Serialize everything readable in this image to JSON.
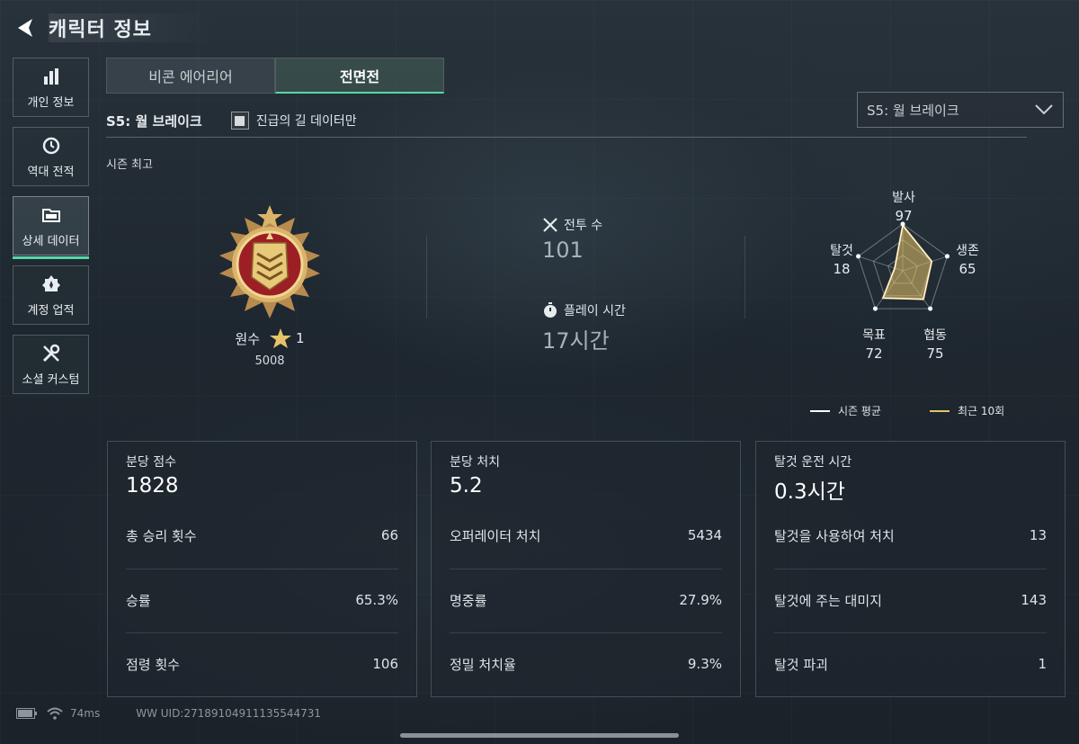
{
  "header": {
    "title": "캐릭터 정보"
  },
  "sidebar": {
    "items": [
      {
        "label": "개인 정보",
        "icon": "bar-chart-icon"
      },
      {
        "label": "역대 전적",
        "icon": "history-icon"
      },
      {
        "label": "상세 데이터",
        "icon": "folder-icon",
        "active": true
      },
      {
        "label": "계정 업적",
        "icon": "achievement-icon"
      },
      {
        "label": "소셜 커스텀",
        "icon": "tools-icon"
      }
    ]
  },
  "tabs": [
    {
      "label": "비콘 에어리어",
      "active": false
    },
    {
      "label": "전면전",
      "active": true
    }
  ],
  "season": {
    "label": "S5: 월 브레이크",
    "checkbox_label": "진급의 길 데이터만",
    "select_value": "S5: 월 브레이크"
  },
  "season_best": "시즌 최고",
  "rank": {
    "name": "원수",
    "stars": "1",
    "score": "5008"
  },
  "stats": {
    "battles_label": "전투 수",
    "battles_value": "101",
    "playtime_label": "플레이 시간",
    "playtime_value": "17시간"
  },
  "radar": {
    "axes": [
      {
        "label": "발사",
        "value": "97"
      },
      {
        "label": "생존",
        "value": "65"
      },
      {
        "label": "협동",
        "value": "75"
      },
      {
        "label": "목표",
        "value": "72"
      },
      {
        "label": "탈것",
        "value": "18"
      }
    ],
    "legend_avg": "시즌 평균",
    "legend_recent": "최근 10회",
    "color_avg": "#ffffff",
    "color_recent": "#e6c36a"
  },
  "cards": [
    {
      "title": "분당 점수",
      "main": "1828",
      "rows": [
        {
          "label": "총 승리 횟수",
          "value": "66"
        },
        {
          "label": "승률",
          "value": "65.3%"
        },
        {
          "label": "점령 횟수",
          "value": "106"
        }
      ]
    },
    {
      "title": "분당 처치",
      "main": "5.2",
      "rows": [
        {
          "label": "오퍼레이터 처치",
          "value": "5434"
        },
        {
          "label": "명중률",
          "value": "27.9%"
        },
        {
          "label": "정밀 처치율",
          "value": "9.3%"
        }
      ]
    },
    {
      "title": "탈것 운전 시간",
      "main": "0.3시간",
      "rows": [
        {
          "label": "탈것을 사용하여 처치",
          "value": "13"
        },
        {
          "label": "탈것에 주는 대미지",
          "value": "143"
        },
        {
          "label": "탈것 파괴",
          "value": "1"
        }
      ]
    }
  ],
  "footer": {
    "ping": "74ms",
    "uid": "WW UID:27189104911135544731"
  },
  "colors": {
    "accent": "#58d6a6",
    "gold": "#e6c36a"
  }
}
